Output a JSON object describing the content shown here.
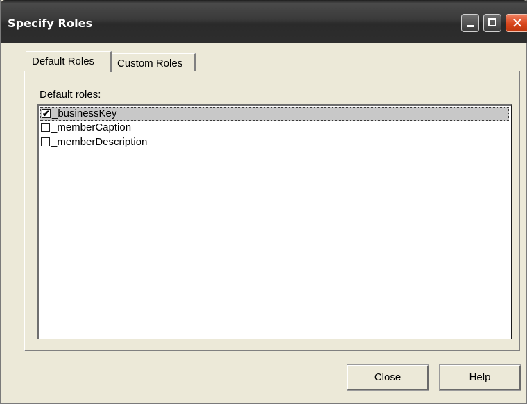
{
  "window": {
    "title": "Specify Roles",
    "controls": {
      "minimize_icon": "minimize-icon",
      "maximize_icon": "maximize-icon",
      "close_icon": "close-icon",
      "close_glyph": "✕"
    }
  },
  "tabs": [
    {
      "label": "Default Roles",
      "selected": true
    },
    {
      "label": "Custom Roles",
      "selected": false
    }
  ],
  "default_roles": {
    "label": "Default roles:",
    "items": [
      {
        "label": "_businessKey",
        "checked": true,
        "selected": true,
        "check_glyph": "✔"
      },
      {
        "label": "_memberCaption",
        "checked": false,
        "selected": false,
        "check_glyph": ""
      },
      {
        "label": "_memberDescription",
        "checked": false,
        "selected": false,
        "check_glyph": ""
      }
    ]
  },
  "buttons": {
    "close_label": "Close",
    "help_label": "Help"
  },
  "colors": {
    "titlebar": "#2e2e2e",
    "close_button": "#d8461c",
    "dialog_background": "#ece9d8",
    "selection": "#c8c8c8"
  }
}
